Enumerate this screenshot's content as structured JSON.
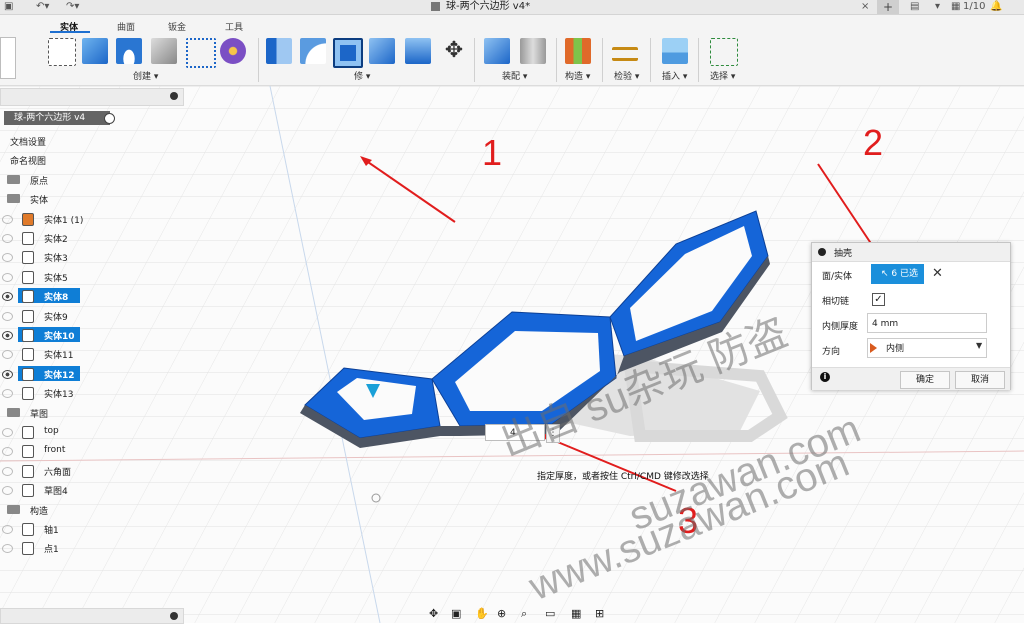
{
  "titlebar": {
    "title": "球-两个六边形 v4*",
    "page_counter": "1/10"
  },
  "ribbon": {
    "tabs": [
      "实体",
      "曲面",
      "钣金",
      "工具"
    ],
    "groups": [
      "创建 ▾",
      "修 ▾",
      "装配 ▾",
      "构造 ▾",
      "检验 ▾",
      "插入 ▾",
      "选择 ▾"
    ]
  },
  "browser": {
    "doc_name": "球-两个六边形 v4",
    "items": [
      {
        "label": "文档设置"
      },
      {
        "label": "命名视图"
      },
      {
        "label": "原点"
      },
      {
        "label": "实体"
      },
      {
        "label": "实体1 (1)"
      },
      {
        "label": "实体2"
      },
      {
        "label": "实体3"
      },
      {
        "label": "实体5"
      },
      {
        "label": "实体8"
      },
      {
        "label": "实体9"
      },
      {
        "label": "实体10"
      },
      {
        "label": "实体11"
      },
      {
        "label": "实体12"
      },
      {
        "label": "实体13"
      },
      {
        "label": "草图"
      },
      {
        "label": "top"
      },
      {
        "label": "front"
      },
      {
        "label": "六角面"
      },
      {
        "label": "草图4"
      },
      {
        "label": "构造"
      },
      {
        "label": "轴1"
      },
      {
        "label": "点1"
      }
    ]
  },
  "shell_dialog": {
    "title": "抽壳",
    "faces_label": "面/实体",
    "faces_value": "6 已选定",
    "tangent_label": "相切链",
    "tangent_check": "✓",
    "thickness_label": "内侧厚度",
    "thickness_value": "4 mm",
    "direction_label": "方向",
    "direction_value": "内侧",
    "ok": "确定",
    "cancel": "取消"
  },
  "canvas": {
    "input_value": "4",
    "hint": "指定厚度，或者按住 Ctrl/CMD 键修改选择"
  },
  "annotations": {
    "n1": "1",
    "n2": "2",
    "n3": "3"
  },
  "watermark": {
    "line1": "出自 su杂玩 防盗",
    "line2": "suzawan.com",
    "line3": "www.suzawan.com"
  },
  "colors": {
    "accent": "#0f7ed6",
    "solid_blue": "#1565d8",
    "callout_red": "#e11d1d"
  }
}
